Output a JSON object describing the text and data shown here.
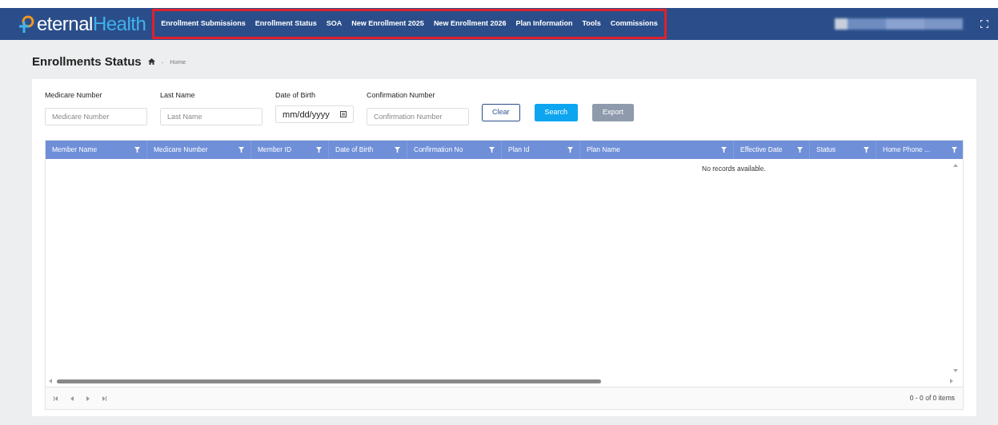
{
  "brand": {
    "part1": "eternal",
    "part2": "Health"
  },
  "nav": {
    "highlighted": true,
    "items": [
      "Enrollment Submissions",
      "Enrollment Status",
      "SOA",
      "New Enrollment 2025",
      "New Enrollment 2026",
      "Plan Information",
      "Tools",
      "Commissions"
    ]
  },
  "page": {
    "title": "Enrollments Status",
    "breadcrumb_separator": "-",
    "breadcrumb": "Home"
  },
  "filters": [
    {
      "label": "Medicare Number",
      "placeholder": "Medicare Number",
      "kind": "text"
    },
    {
      "label": "Last Name",
      "placeholder": "Last Name",
      "kind": "text"
    },
    {
      "label": "Date of Birth",
      "value": "mm/dd/yyyy",
      "kind": "date"
    },
    {
      "label": "Confirmation Number",
      "placeholder": "Confirmation Number",
      "kind": "text"
    }
  ],
  "buttons": [
    {
      "label": "Clear",
      "kind": "outline"
    },
    {
      "label": "Search",
      "kind": "primary"
    },
    {
      "label": "Export",
      "kind": "secondary"
    }
  ],
  "table": {
    "columns": [
      "Member Name",
      "Medicare Number",
      "Member ID",
      "Date of Birth",
      "Confirmation No",
      "Plan Id",
      "Plan Name",
      "Effective Date",
      "Status",
      "Home Phone ..."
    ],
    "empty_message": "No records available.",
    "pager_info": "0 - 0 of 0 items"
  }
}
